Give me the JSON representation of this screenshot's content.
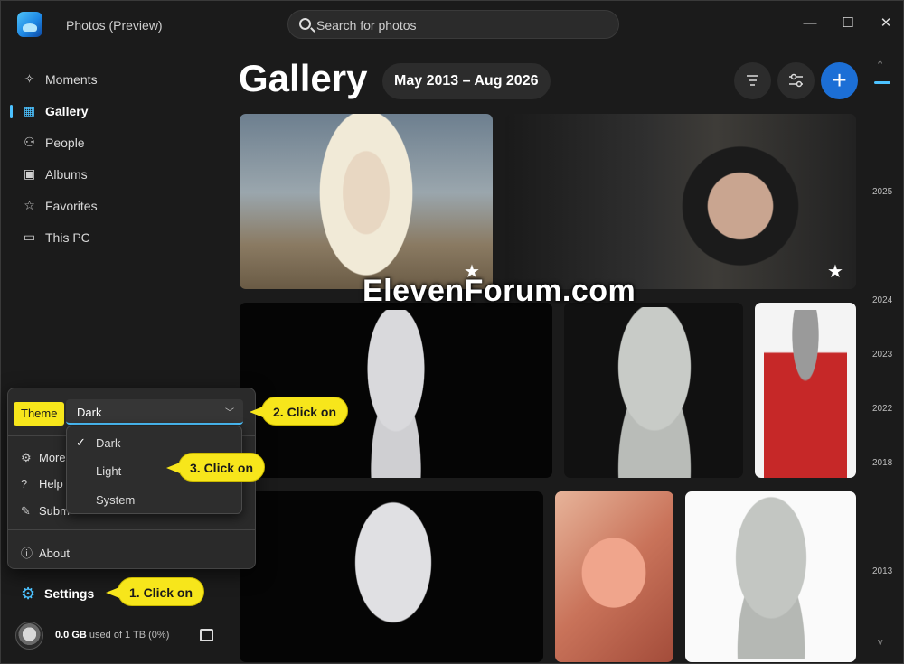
{
  "app": {
    "title": "Photos (Preview)"
  },
  "search": {
    "placeholder": "Search for photos"
  },
  "window_controls": {
    "minimize": "—",
    "maximize": "☐",
    "close": "✕"
  },
  "sidebar": {
    "items": [
      {
        "label": "Moments",
        "icon": "sparkle-icon"
      },
      {
        "label": "Gallery",
        "icon": "grid-icon",
        "active": true
      },
      {
        "label": "People",
        "icon": "people-icon"
      },
      {
        "label": "Albums",
        "icon": "album-icon"
      },
      {
        "label": "Favorites",
        "icon": "star-icon"
      },
      {
        "label": "This PC",
        "icon": "folder-icon"
      }
    ]
  },
  "gallery": {
    "title": "Gallery",
    "date_range": "May 2013 – Aug 2026",
    "add_label": "+"
  },
  "timeline": [
    "2025",
    "2024",
    "2023",
    "2022",
    "2018",
    "2013"
  ],
  "watermark": "ElevenForum.com",
  "flyout": {
    "theme_label": "Theme",
    "theme_value": "Dark",
    "theme_options": [
      "Dark",
      "Light",
      "System"
    ],
    "items": [
      "More",
      "Help",
      "Subm",
      "About"
    ]
  },
  "callouts": {
    "step1": "1. Click on",
    "step2": "2. Click on",
    "step3": "3. Click on"
  },
  "settings_label": "Settings",
  "storage": {
    "used": "0.0 GB",
    "rest": "used of 1 TB (0%)"
  },
  "colors": {
    "accent": "#4cc2ff",
    "add_button": "#1c6fd6",
    "callout": "#f7e61b"
  }
}
